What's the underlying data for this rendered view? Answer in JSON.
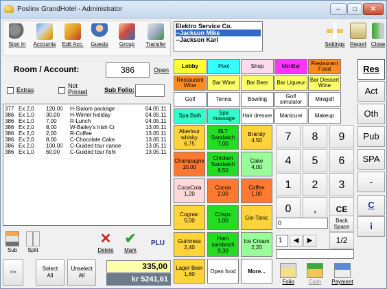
{
  "window": {
    "title": "Poslinx GrandHotel - Administrator",
    "minimize": "–",
    "maximize": "□",
    "close": "✕"
  },
  "toolbar": {
    "sign_in": "Sign In",
    "accounts": "Accounts",
    "edit_acc": "Edit Acc.",
    "guests": "Guests",
    "group": "Group",
    "transfer": "Transfer",
    "settings": "Settings",
    "report": "Report",
    "close": "Close"
  },
  "company_list": {
    "company": "Elektro Service Co.",
    "items": [
      "--Jackson Mike",
      "--Jackson Karl"
    ]
  },
  "room": {
    "label": "Room / Account:",
    "value": "386",
    "open": "Open",
    "extras": "Extras",
    "not_printed_1": "Not",
    "not_printed_2": "Printed",
    "sub_folio": "Sub Folio:"
  },
  "transactions": [
    {
      "room": "377",
      "ex": "Ex 2,0",
      "amount": "120,00",
      "desc": "H-Slalom package",
      "date": "04.05.11"
    },
    {
      "room": "386",
      "ex": "Ex 1,0",
      "amount": "30,00",
      "desc": "H-Winter holiday",
      "date": "04.05.11"
    },
    {
      "room": "386",
      "ex": "Ex 1,0",
      "amount": "7,00",
      "desc": "R-Lunch",
      "date": "04.05.11"
    },
    {
      "room": "386",
      "ex": "Ex 2,0",
      "amount": "8,00",
      "desc": "W-Bailey's Irish Cr",
      "date": "13.05.11"
    },
    {
      "room": "386",
      "ex": "Ex 2,0",
      "amount": "2,00",
      "desc": "R-Coffee",
      "date": "13.05.11"
    },
    {
      "room": "386",
      "ex": "Ex 2,0",
      "amount": "8,00",
      "desc": "C-Chocolate Cake",
      "date": "13.05.11"
    },
    {
      "room": "386",
      "ex": "Ex 2,0",
      "amount": "100,00",
      "desc": "C-Guided tour canoe",
      "date": "13.05.11"
    },
    {
      "room": "386",
      "ex": "Ex 1,0",
      "amount": "60,00",
      "desc": "C-Guided tour fishi",
      "date": "13.05.11"
    }
  ],
  "bottom_left": {
    "sub": "Sub",
    "split": "Split",
    "delete": "Delete",
    "mark": "Mark",
    "plu": "PLU",
    "more_arrows": ">>",
    "select_all_1": "Select",
    "select_all_2": "All",
    "unselect_all_1": "Unselect",
    "unselect_all_2": "All",
    "total": "335,00",
    "total_kr": "kr 5241,61"
  },
  "categories": [
    {
      "label": "Lobby",
      "color": "#ffff33",
      "bold": true
    },
    {
      "label": "Pool",
      "color": "#33ffff"
    },
    {
      "label": "Shop",
      "color": "#ffd9ec"
    },
    {
      "label": "MiniBar",
      "color": "#ff33ff"
    },
    {
      "label": "Restaurant Food",
      "color": "#ff8a1f"
    },
    {
      "label": "Restaurant Wine",
      "color": "#ff8a1f"
    },
    {
      "label": "Bar Wine",
      "color": "#ffff66"
    },
    {
      "label": "Bar Beer",
      "color": "#ffff66"
    },
    {
      "label": "Bar Liqueur",
      "color": "#ffff66"
    },
    {
      "label": "Bar Dessert Wine",
      "color": "#ffff66"
    },
    {
      "label": "Golf",
      "color": "#ffffff"
    },
    {
      "label": "Tennis",
      "color": "#ffffff"
    },
    {
      "label": "Bowling",
      "color": "#ffffff"
    },
    {
      "label": "Golf simulator",
      "color": "#ffffff"
    },
    {
      "label": "Minigolf",
      "color": "#ffffff"
    },
    {
      "label": "Spa Bath",
      "color": "#33ffcc"
    },
    {
      "label": "Spa massage",
      "color": "#33ffcc"
    },
    {
      "label": "Hair dresser",
      "color": "#ffffff"
    },
    {
      "label": "Manicure",
      "color": "#ffffff"
    },
    {
      "label": "Makeup",
      "color": "#ffffff"
    }
  ],
  "products": [
    {
      "name": "Aberlour whisky",
      "price": "6,75",
      "color": "#ffd33a"
    },
    {
      "name": "BLT Sandwich",
      "price": "7,00",
      "color": "#22dd22"
    },
    {
      "name": "Brandy",
      "price": "4,50",
      "color": "#ffd33a"
    },
    {
      "name": "Champagne",
      "price": "10,00",
      "color": "#ff7a30"
    },
    {
      "name": "Chicken Sandwich",
      "price": "8,50",
      "color": "#22dd22"
    },
    {
      "name": "Cake",
      "price": "4,00",
      "color": "#99ff99"
    },
    {
      "name": "CocaCola",
      "price": "1,20",
      "color": "#ffd9d9"
    },
    {
      "name": "Cocoa",
      "price": "2,00",
      "color": "#ff7a30"
    },
    {
      "name": "Coffee",
      "price": "1,00",
      "color": "#ff7a30"
    },
    {
      "name": "Cognac",
      "price": "5,00",
      "color": "#ffd33a"
    },
    {
      "name": "Crisps",
      "price": "1,00",
      "color": "#22dd22"
    },
    {
      "name": "Gin-Tonic",
      "price": "",
      "color": "#ffd33a"
    },
    {
      "name": "Guinness",
      "price": "2,40",
      "color": "#ffd33a"
    },
    {
      "name": "Ham sandwich",
      "price": "9,30",
      "color": "#22dd22"
    },
    {
      "name": "Ice Cream",
      "price": "2,20",
      "color": "#99ff99"
    },
    {
      "name": "Lager Beer",
      "price": "1,60",
      "color": "#ffd33a"
    },
    {
      "name": "Open food",
      "price": "",
      "color": "#ffffff"
    },
    {
      "name": "More...",
      "price": "",
      "color": "#ffffff"
    }
  ],
  "keypad": {
    "k7": "7",
    "k8": "8",
    "k9": "9",
    "k4": "4",
    "k5": "5",
    "k6": "6",
    "k1": "1",
    "k2": "2",
    "k3": "3",
    "k0": "0",
    "kcomma": ",",
    "kce": "CE",
    "display": "0",
    "back_1": "Back",
    "back_2": "Space",
    "qty": "1",
    "left": "◀",
    "right": "▶",
    "half": "1/2",
    "folio": "Folio",
    "cash": "Cash",
    "payment": "Payment"
  },
  "side_menu": [
    "Res",
    "Act",
    "Oth",
    "Pub",
    "SPA",
    "-",
    "C",
    "i"
  ]
}
